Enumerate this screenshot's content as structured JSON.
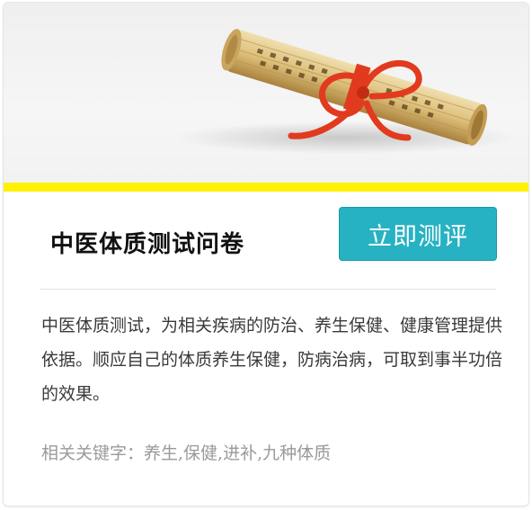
{
  "card": {
    "image_alt": "scroll-with-red-ribbon",
    "accent_color": "#fff100",
    "title": "中医体质测试问卷",
    "cta_label": "立即测评",
    "cta_color": "#26b2c3",
    "description": "中医体质测试，为相关疾病的防治、养生保健、健康管理提供依据。顺应自己的体质养生保健，防病治病，可取到事半功倍的效果。",
    "keywords": "相关关键字：养生,保健,进补,九种体质"
  }
}
